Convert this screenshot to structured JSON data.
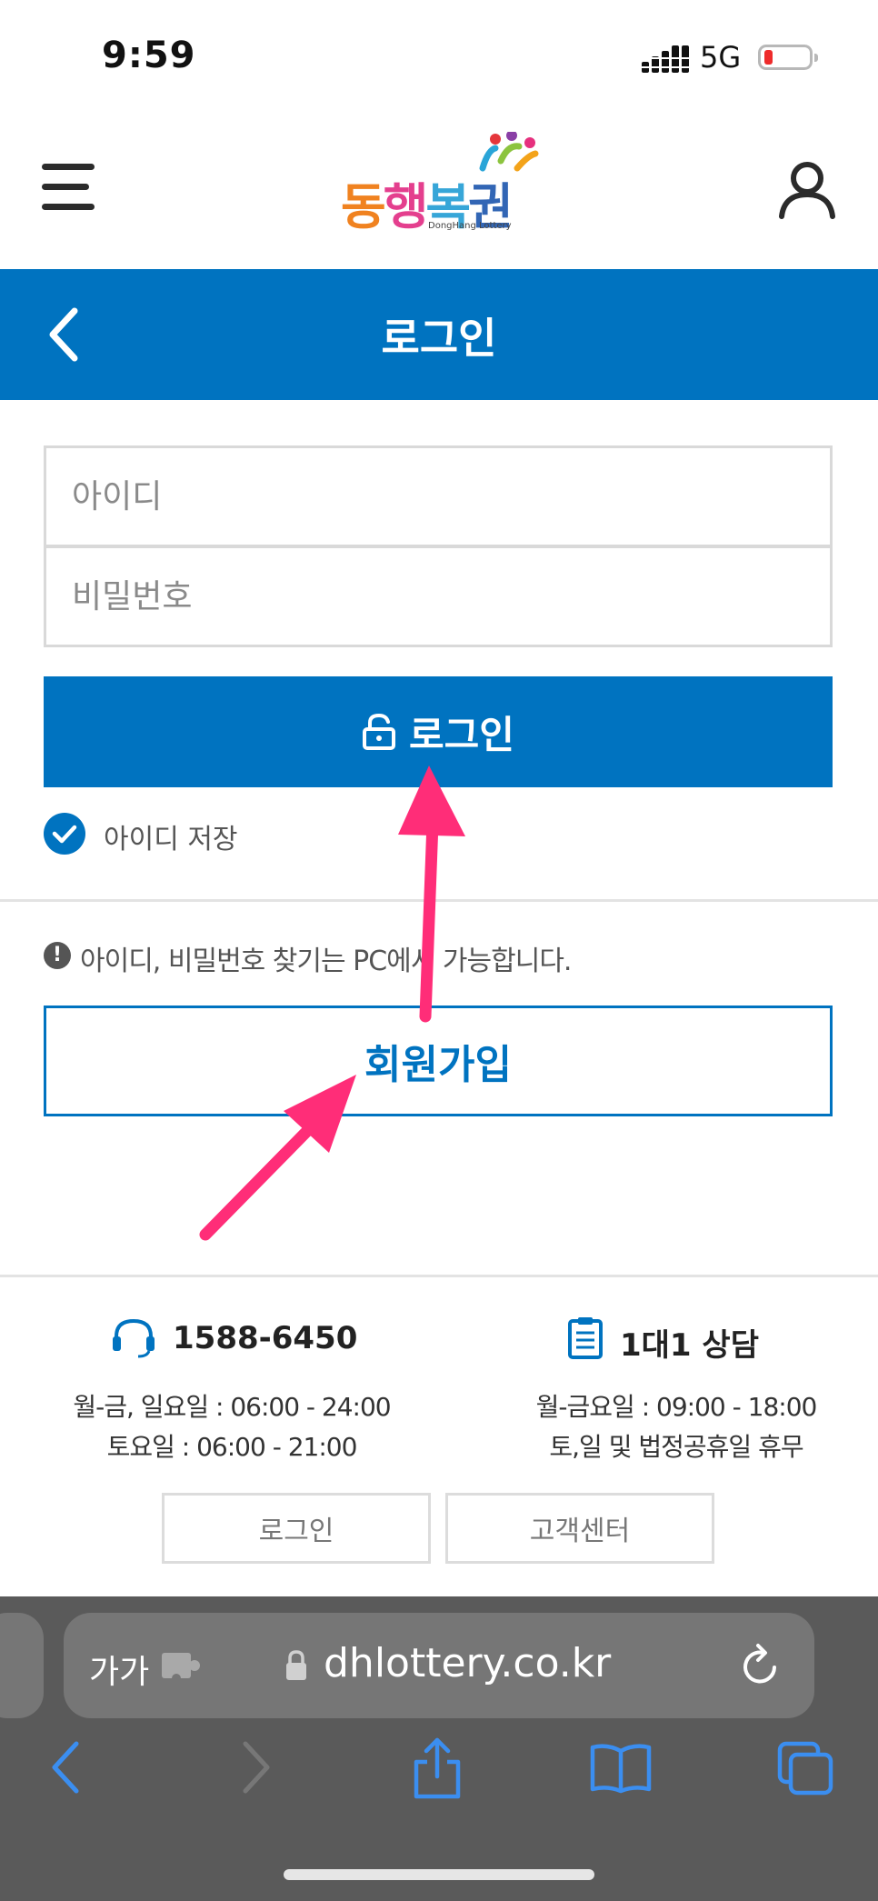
{
  "status_bar": {
    "time": "9:59",
    "network": "5G",
    "battery_level": 0.1
  },
  "header": {
    "logo_text": "동행복권",
    "logo_subtext": "DongHang Lottery",
    "menu_icon": "hamburger-icon",
    "user_icon": "user-icon"
  },
  "title_bar": {
    "title": "로그인",
    "back_icon": "chevron-left-icon"
  },
  "form": {
    "id_placeholder": "아이디",
    "password_placeholder": "비밀번호",
    "login_label": "로그인",
    "save_id_label": "아이디 저장",
    "save_id_checked": true,
    "notice": "아이디, 비밀번호 찾기는 PC에서 가능합니다.",
    "signup_label": "회원가입"
  },
  "footer": {
    "phone": "1588-6450",
    "phone_hours": [
      "월-금, 일요일 : 06:00 - 24:00",
      "토요일 : 06:00 - 21:00"
    ],
    "consult_title": "1대1 상담",
    "consult_hours": [
      "월-금요일 : 09:00 - 18:00",
      "토,일 및 법정공휴일 휴무"
    ],
    "buttons": [
      "로그인",
      "고객센터"
    ]
  },
  "browser": {
    "text_size_label": "가가",
    "url": "dhlottery.co.kr",
    "toolbar_icons": [
      "back-icon",
      "forward-icon",
      "share-icon",
      "bookmarks-icon",
      "tabs-icon"
    ]
  },
  "colors": {
    "brand_blue": "#0073c0",
    "annotation_pink": "#ff2d78"
  }
}
